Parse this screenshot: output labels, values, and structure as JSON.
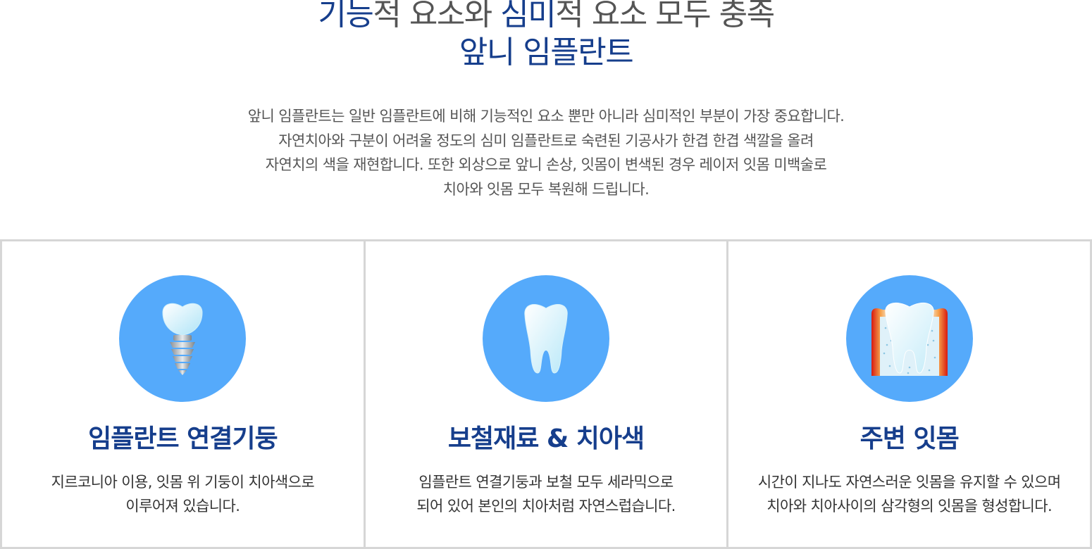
{
  "headline": {
    "line1_part1": "기능",
    "line1_part2": "적 요소와 ",
    "line1_part3": "심미",
    "line1_part4": "적 요소 모두 충족",
    "line2": "앞니 임플란트"
  },
  "intro": {
    "lines": [
      "앞니 임플란트는 일반 임플란트에 비해 기능적인 요소 뿐만 아니라 심미적인 부분이 가장 중요합니다.",
      "자연치아와 구분이 어려울 정도의 심미 임플란트로 숙련된 기공사가 한겹 한겹 색깔을 올려",
      "자연치의 색을 재현합니다. 또한 외상으로 앞니 손상, 잇몸이 변색된 경우 레이저 잇몸 미백술로",
      "치아와 잇몸 모두 복원해 드립니다."
    ]
  },
  "features": [
    {
      "icon": "implant-icon",
      "title": "임플란트 연결기둥",
      "desc": [
        "지르코니아 이용, 잇몸 위 기둥이 치아색으로",
        "이루어져 있습니다."
      ]
    },
    {
      "icon": "tooth-icon",
      "title": "보철재료 & 치아색",
      "desc": [
        "임플란트 연결기둥과 보철 모두 세라믹으로",
        "되어 있어 본인의 치아처럼 자연스럽습니다."
      ]
    },
    {
      "icon": "gum-tooth-icon",
      "title": "주변 잇몸",
      "desc": [
        "시간이 지나도 자연스러운 잇몸을 유지할 수 있으며",
        "치아와 치아사이의 삼각형의 잇몸을 형성합니다."
      ]
    }
  ],
  "colors": {
    "accent_blue": "#163e8c",
    "icon_circle": "#55aafb",
    "border": "#d6d6d6",
    "text_gray": "#555555"
  }
}
